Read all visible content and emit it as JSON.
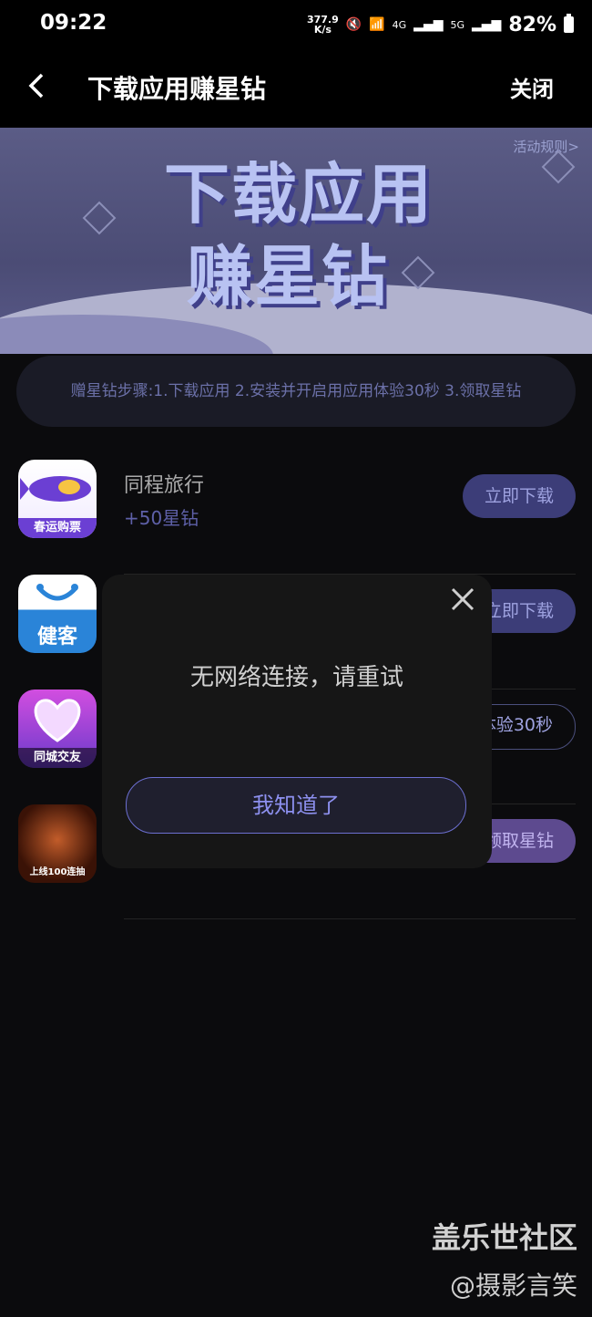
{
  "status": {
    "time": "09:22",
    "speed_value": "377.9",
    "speed_unit": "K/s",
    "network1": "4G",
    "network2": "5G",
    "battery": "82%"
  },
  "nav": {
    "title": "下载应用赚星钻",
    "close": "关闭"
  },
  "banner": {
    "rule_link": "活动规则>",
    "title_line1": "下载应用",
    "title_line2": "赚星钻"
  },
  "steps": "赠星钻步骤:1.下载应用 2.安装并开启用应用体验30秒 3.领取星钻",
  "apps": [
    {
      "name": "同程旅行",
      "reward": "+50星钻",
      "button": "立即下载",
      "icon_tag": "春运购票",
      "icon_color": "#6b3fd3"
    },
    {
      "name": "",
      "reward": "",
      "button": "立即下载",
      "icon_tag": "健客",
      "icon_color": "#2a84d8"
    },
    {
      "name": "",
      "reward": "",
      "button": "体验30秒",
      "icon_tag": "同城交友",
      "icon_color": "#8c4fd9"
    },
    {
      "name": "",
      "reward": "",
      "button": "领取星钻",
      "icon_tag": "上线100连抽",
      "icon_color": "#6a2a12"
    }
  ],
  "modal": {
    "message": "无网络连接，请重试",
    "button": "我知道了"
  },
  "watermark": {
    "line1": "盖乐世社区",
    "line2": "@摄影言笑"
  }
}
